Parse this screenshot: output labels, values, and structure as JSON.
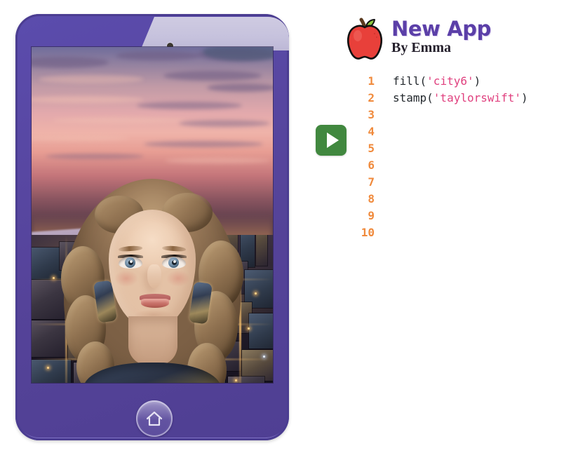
{
  "app": {
    "title": "New App",
    "author": "By Emma",
    "logo_icon": "apple-icon",
    "title_color": "#5b3fa8",
    "author_color": "#241f2b"
  },
  "toolbar": {
    "run_label": "",
    "run_icon": "play-icon",
    "run_color": "#41883f"
  },
  "editor": {
    "gutter_color": "#f08a3c",
    "string_color": "#e0417f",
    "code_color": "#24292e",
    "line_numbers": [
      "1",
      "2",
      "3",
      "4",
      "5",
      "6",
      "7",
      "8",
      "9",
      "10"
    ],
    "lines": [
      {
        "number": "1",
        "text": "fill('city6')",
        "tokens": [
          {
            "type": "fn",
            "text": "fill("
          },
          {
            "type": "str",
            "text": "'city6'"
          },
          {
            "type": "punc",
            "text": ")"
          }
        ]
      },
      {
        "number": "2",
        "text": "stamp('taylorswift')",
        "tokens": [
          {
            "type": "fn",
            "text": "stamp("
          },
          {
            "type": "str",
            "text": "'taylorswift'"
          },
          {
            "type": "punc",
            "text": ")"
          }
        ]
      },
      {
        "number": "3",
        "text": "",
        "tokens": []
      },
      {
        "number": "4",
        "text": "",
        "tokens": []
      },
      {
        "number": "5",
        "text": "",
        "tokens": []
      },
      {
        "number": "6",
        "text": "",
        "tokens": []
      },
      {
        "number": "7",
        "text": "",
        "tokens": []
      },
      {
        "number": "8",
        "text": "",
        "tokens": []
      },
      {
        "number": "9",
        "text": "",
        "tokens": []
      },
      {
        "number": "10",
        "text": "",
        "tokens": []
      }
    ]
  },
  "device": {
    "frame_color": "#554399",
    "bezel_highlight_color": "#c6c2dd",
    "home_icon": "home-icon",
    "camera_icon": "camera-dot-icon"
  },
  "canvas": {
    "background_image": "city6",
    "stamp_image": "taylorswift",
    "description": "Aerial sunset cityscape with a stamped portrait photo centered on the screen"
  }
}
